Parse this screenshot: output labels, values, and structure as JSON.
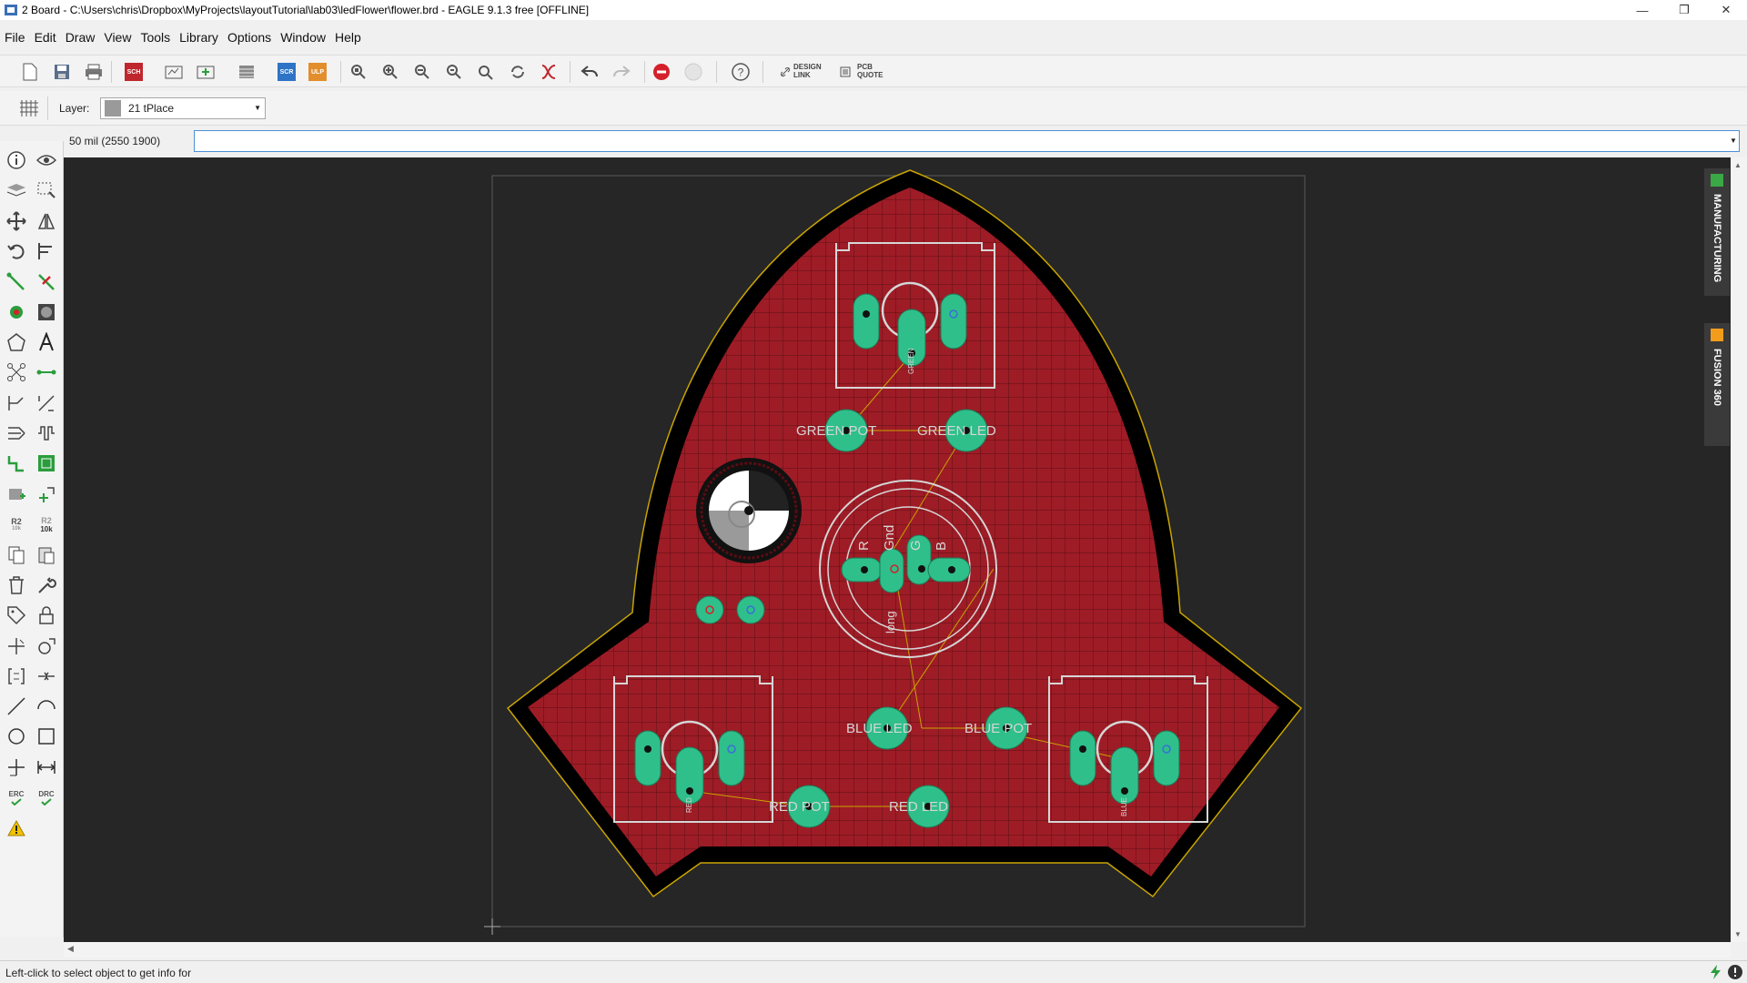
{
  "window": {
    "title": "2 Board - C:\\Users\\chris\\Dropbox\\MyProjects\\layoutTutorial\\lab03\\ledFlower\\flower.brd - EAGLE 9.1.3 free [OFFLINE]",
    "minimize": "—",
    "maximize": "❐",
    "close": "✕"
  },
  "menu": [
    "File",
    "Edit",
    "Draw",
    "View",
    "Tools",
    "Library",
    "Options",
    "Window",
    "Help"
  ],
  "toolbar": {
    "sch": "SCH",
    "scr": "SCR",
    "ulp": "ULP",
    "design_link_1": "DESIGN",
    "design_link_2": "LINK",
    "pcb_quote_1": "PCB",
    "pcb_quote_2": "QUOTE",
    "help": "?"
  },
  "layerbar": {
    "label": "Layer:",
    "selected_layer": "21 tPlace"
  },
  "command": {
    "coordinate": "50 mil (2550 1900)",
    "input_value": ""
  },
  "lefttools": {
    "r2_label": "R2",
    "r2_sub": "10k",
    "r2b_label": "R2",
    "r2b_sub": "10k",
    "erc": "ERC",
    "drc": "DRC"
  },
  "board": {
    "labels": {
      "green_pot": "GREEN POT",
      "green_led": "GREEN LED",
      "blue_led": "BLUE LED",
      "blue_pot": "BLUE POT",
      "red_pot": "RED POT",
      "red_led": "RED LED",
      "rgb_r": "R",
      "rgb_gnd": "Gnd",
      "rgb_g": "G",
      "rgb_b": "B",
      "rgb_long": "long",
      "green_small": "GREEN",
      "red_small": "RED",
      "blue_small": "BLUE"
    },
    "colors": {
      "background": "#262626",
      "board_fill": "#9e1c26",
      "outline": "#000000",
      "dimension": "#c9a400",
      "pad": "#2fbf8a",
      "silkscreen": "#d6d6d6",
      "grid": "#5a1014",
      "airwire": "#c9a400"
    }
  },
  "sidepanel": {
    "manufacturing": "MANUFACTURING",
    "fusion": "FUSION 360"
  },
  "status": {
    "message": "Left-click to select object to get info for"
  }
}
